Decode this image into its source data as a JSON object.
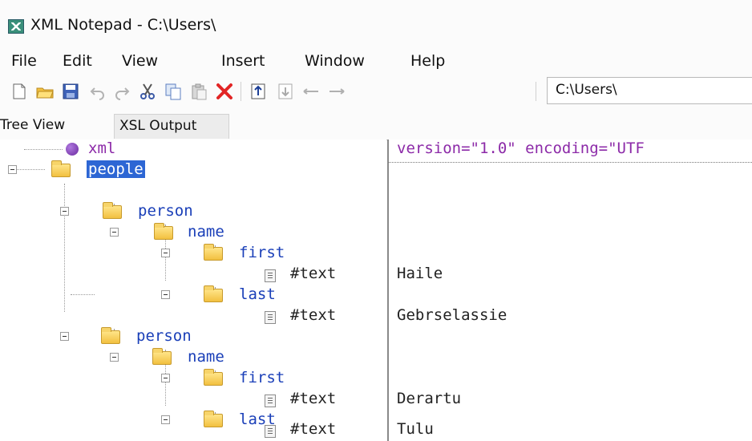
{
  "window": {
    "title": "XML Notepad - C:\\Users\\"
  },
  "menu": {
    "items": [
      "File",
      "Edit",
      "View",
      "Insert",
      "Window",
      "Help"
    ]
  },
  "toolbar": {
    "buttons": [
      {
        "icon": "new-file-icon"
      },
      {
        "icon": "open-folder-icon"
      },
      {
        "icon": "save-icon"
      },
      {
        "icon": "undo-icon"
      },
      {
        "icon": "redo-icon"
      },
      {
        "icon": "cut-icon"
      },
      {
        "icon": "copy-icon"
      },
      {
        "icon": "paste-icon"
      },
      {
        "icon": "delete-icon"
      },
      {
        "icon": "nudge-up-icon"
      },
      {
        "icon": "nudge-down-icon"
      },
      {
        "icon": "nudge-left-icon"
      },
      {
        "icon": "nudge-right-icon"
      }
    ],
    "location": "C:\\Users\\"
  },
  "tabs": [
    "Tree View",
    "XSL Output"
  ],
  "tree": [
    {
      "label": "xml",
      "value": "version=\"1.0\" encoding=\"UTF"
    },
    {
      "label": "people",
      "value": "",
      "selected": true
    },
    {
      "label": "person",
      "value": ""
    },
    {
      "label": "name",
      "value": ""
    },
    {
      "label": "first",
      "value": ""
    },
    {
      "label": "#text",
      "value": "Haile"
    },
    {
      "label": "last",
      "value": ""
    },
    {
      "label": "#text",
      "value": "Gebrselassie"
    },
    {
      "label": "person",
      "value": ""
    },
    {
      "label": "name",
      "value": ""
    },
    {
      "label": "first",
      "value": ""
    },
    {
      "label": "#text",
      "value": "Derartu"
    },
    {
      "label": "last",
      "value": ""
    },
    {
      "label": "#text",
      "value": "Tulu"
    }
  ],
  "colors": {
    "selection": "#2d66d4",
    "element_text": "#1a3fb8",
    "pi_text": "#8c2aa8"
  }
}
